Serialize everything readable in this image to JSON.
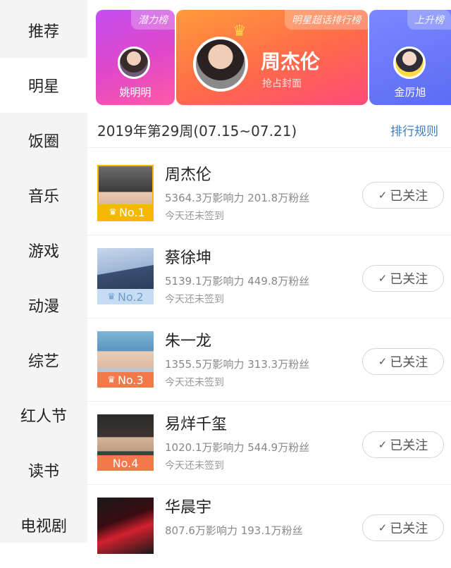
{
  "sidebar": {
    "items": [
      {
        "label": "推荐"
      },
      {
        "label": "明星",
        "active": true
      },
      {
        "label": "饭圈"
      },
      {
        "label": "音乐"
      },
      {
        "label": "游戏"
      },
      {
        "label": "动漫"
      },
      {
        "label": "综艺"
      },
      {
        "label": "红人节"
      },
      {
        "label": "读书"
      },
      {
        "label": "电视剧"
      }
    ]
  },
  "banner": {
    "left": {
      "tag": "潜力榜",
      "name": "姚明明"
    },
    "main": {
      "tag": "明星超话排行榜",
      "name": "周杰伦",
      "subtitle": "抢占封面"
    },
    "right": {
      "tag": "上升榜",
      "name": "金厉旭"
    }
  },
  "week": {
    "label": "2019年第29周(07.15~07.21)",
    "rules": "排行规则"
  },
  "ranking": [
    {
      "name": "周杰伦",
      "stats": "5364.3万影响力 201.8万粉丝",
      "sign": "今天还未签到",
      "badge": "No.1",
      "badge_color": "#f5b800",
      "follow": "已关注"
    },
    {
      "name": "蔡徐坤",
      "stats": "5139.1万影响力 449.8万粉丝",
      "sign": "今天还未签到",
      "badge": "No.2",
      "badge_color": "#8fb6e0",
      "follow": "已关注"
    },
    {
      "name": "朱一龙",
      "stats": "1355.5万影响力 313.3万粉丝",
      "sign": "今天还未签到",
      "badge": "No.3",
      "badge_color": "#f27a4a",
      "follow": "已关注"
    },
    {
      "name": "易烊千玺",
      "stats": "1020.1万影响力 544.9万粉丝",
      "sign": "今天还未签到",
      "badge": "No.4",
      "badge_color": "#f27a4a",
      "follow": "已关注"
    },
    {
      "name": "华晨宇",
      "stats": "807.6万影响力 193.1万粉丝",
      "sign": "",
      "badge": "",
      "badge_color": "",
      "follow": "已关注"
    }
  ],
  "icons": {
    "crown": "crown-icon",
    "check": "check-icon"
  }
}
